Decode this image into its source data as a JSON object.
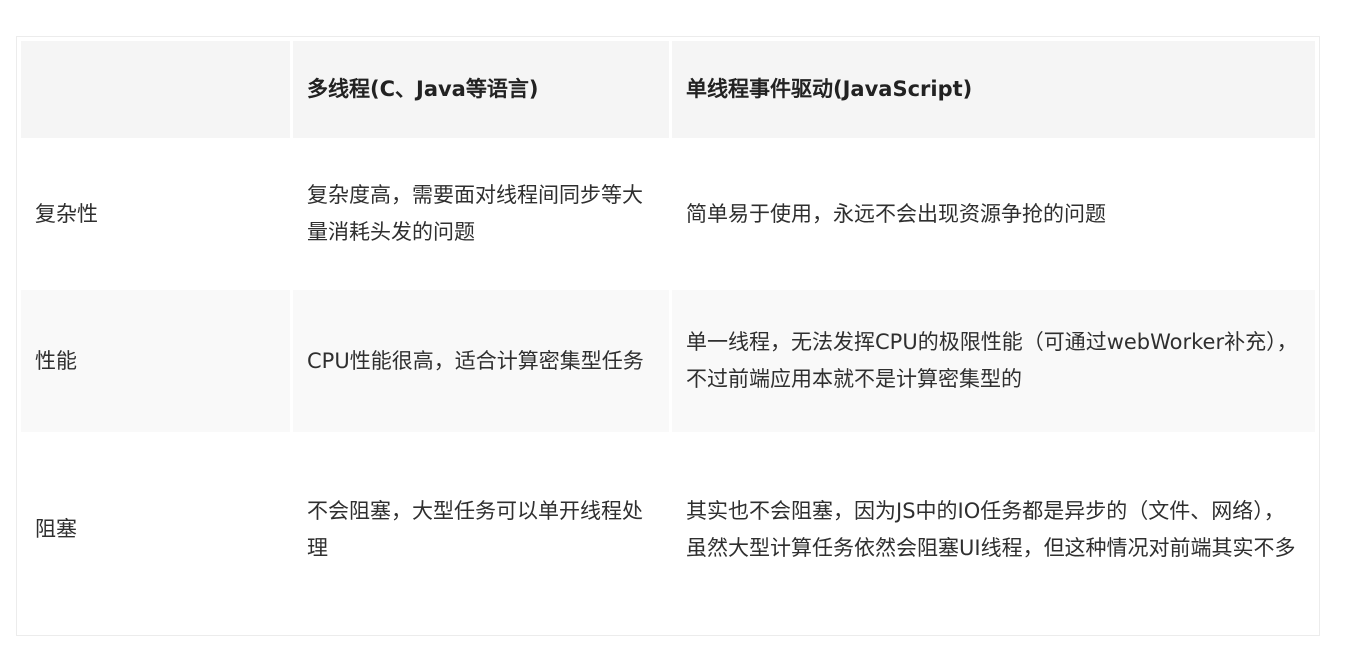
{
  "table": {
    "headers": [
      "",
      "多线程(C、Java等语言)",
      "单线程事件驱动(JavaScript)"
    ],
    "rows": [
      {
        "aspect": "复杂性",
        "multi_thread": "复杂度高，需要面对线程间同步等大量消耗头发的问题",
        "single_thread": "简单易于使用，永远不会出现资源争抢的问题"
      },
      {
        "aspect": "性能",
        "multi_thread": "CPU性能很高，适合计算密集型任务",
        "single_thread": "单一线程，无法发挥CPU的极限性能（可通过webWorker补充），不过前端应用本就不是计算密集型的"
      },
      {
        "aspect": "阻塞",
        "multi_thread": "不会阻塞，大型任务可以单开线程处理",
        "single_thread": "其实也不会阻塞，因为JS中的IO任务都是异步的（文件、网络），虽然大型计算任务依然会阻塞UI线程，但这种情况对前端其实不多"
      }
    ]
  }
}
